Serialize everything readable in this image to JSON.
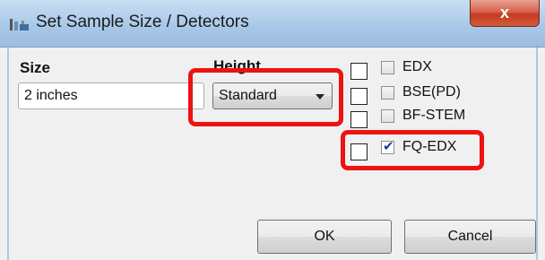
{
  "window": {
    "title": "Set Sample Size / Detectors",
    "close_label": "x"
  },
  "size": {
    "label": "Size",
    "value": "2 inches"
  },
  "height": {
    "label": "Height",
    "value": "Standard"
  },
  "detectors": [
    {
      "label": "EDX",
      "checked": false
    },
    {
      "label": "BSE(PD)",
      "checked": false
    },
    {
      "label": "BF-STEM",
      "checked": false
    },
    {
      "label": "FQ-EDX",
      "checked": true
    }
  ],
  "buttons": {
    "ok": "OK",
    "cancel": "Cancel"
  },
  "colors": {
    "highlight": "#ef1212",
    "titlebar": "#a9c8e8"
  }
}
